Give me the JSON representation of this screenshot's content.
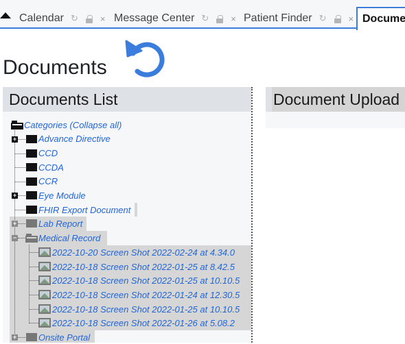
{
  "tabs": [
    {
      "label": "Calendar",
      "active": false
    },
    {
      "label": "Message Center",
      "active": false
    },
    {
      "label": "Patient Finder",
      "active": false
    },
    {
      "label": "Documents",
      "active": true
    }
  ],
  "tab_icons": {
    "refresh": "refresh-icon",
    "lock": "lock-icon",
    "close": "×"
  },
  "page": {
    "title": "Documents",
    "refresh_icon": "refresh-icon"
  },
  "documents_list": {
    "header": "Documents List",
    "root": "Categories (Collapse all)",
    "categories": [
      {
        "label": "Advance Directive",
        "expander": "+"
      },
      {
        "label": "CCD",
        "expander": ""
      },
      {
        "label": "CCDA",
        "expander": ""
      },
      {
        "label": "CCR",
        "expander": ""
      },
      {
        "label": "Eye Module",
        "expander": "+"
      },
      {
        "label": "FHIR Export Document",
        "expander": ""
      },
      {
        "label": "Lab Report",
        "expander": "+"
      },
      {
        "label": "Medical Record",
        "expander": "−"
      },
      {
        "label": "Onsite Portal",
        "expander": "+"
      }
    ],
    "medical_record_files": [
      "2022-10-20 Screen Shot 2022-02-24 at 4.34.0",
      "2022-10-18 Screen Shot 2022-01-25 at 8.42.5",
      "2022-10-18 Screen Shot 2022-01-25 at 10.10.5",
      "2022-10-18 Screen Shot 2022-01-24 at 12.30.5",
      "2022-10-18 Screen Shot 2022-01-25 at 10.10.5",
      "2022-10-18 Screen Shot 2022-01-26 at 5.08.2"
    ]
  },
  "document_upload": {
    "header": "Document Upload"
  },
  "colors": {
    "accent": "#3b7ddd",
    "link": "#2166d8",
    "panel_header": "#dee1e5",
    "highlight": "#d6d6d6"
  }
}
